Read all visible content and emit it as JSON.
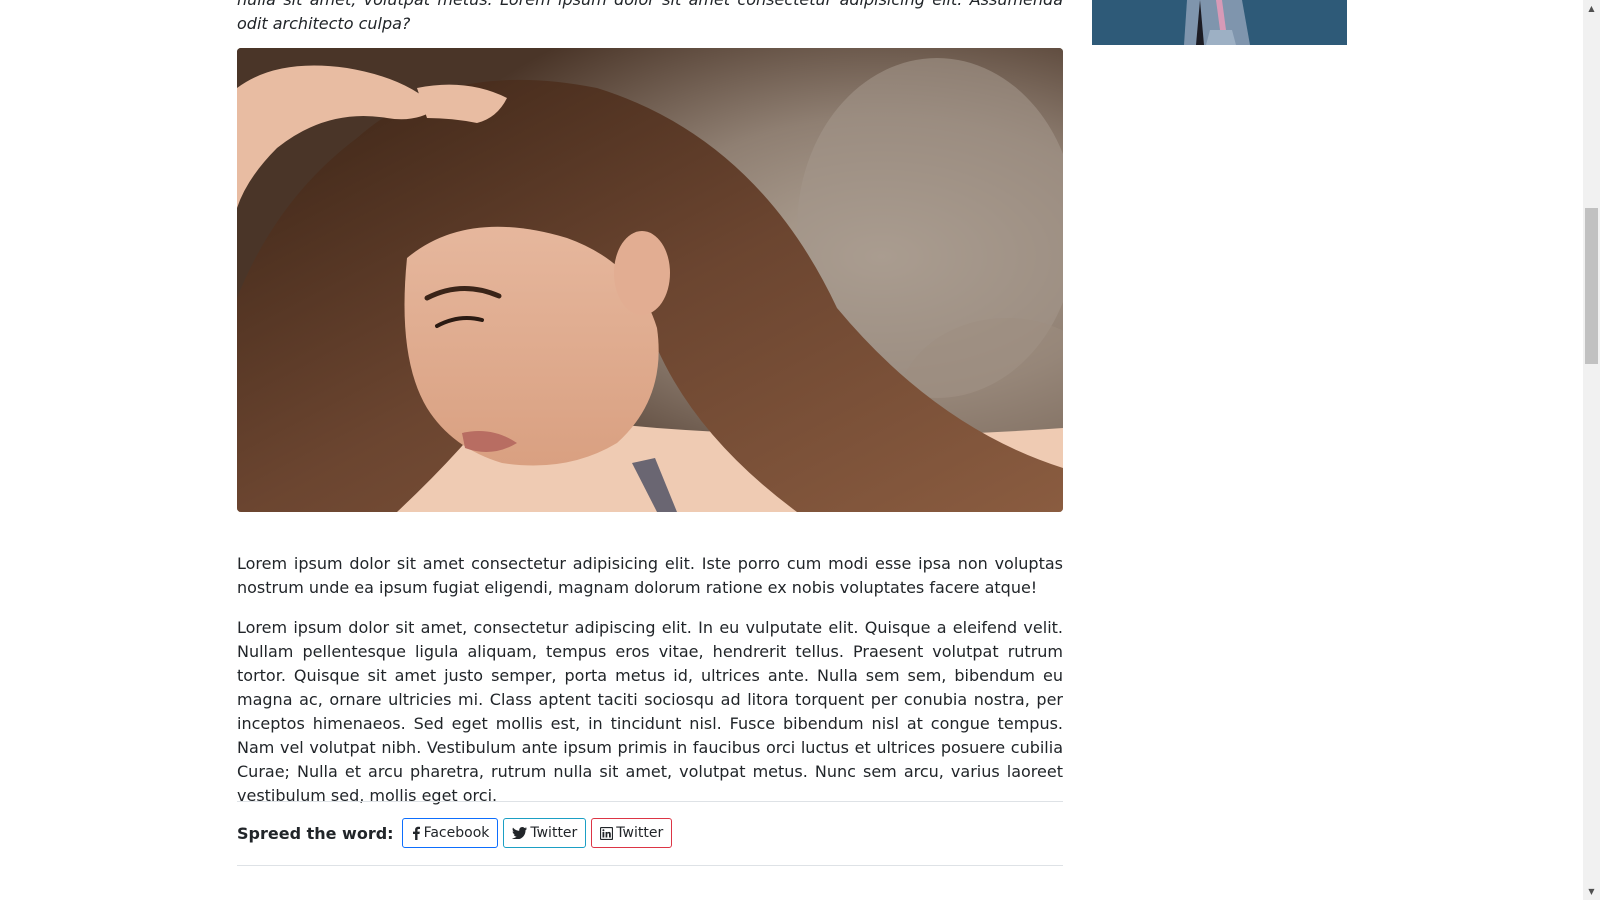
{
  "article": {
    "intro_partial": "nulla sit amet, volutpat metus. Lorem ipsum dolor sit amet consectetur adipisicing elit. Assumenda odit architecto culpa?",
    "paragraph_1": "Lorem ipsum dolor sit amet consectetur adipisicing elit. Iste porro cum modi esse ipsa non voluptas nostrum unde ea ipsum fugiat eligendi, magnam dolorum ratione ex nobis voluptates facere atque!",
    "paragraph_2": "Lorem ipsum dolor sit amet, consectetur adipiscing elit. In eu vulputate elit. Quisque a eleifend velit. Nullam pellentesque ligula aliquam, tempus eros vitae, hendrerit tellus. Praesent volutpat rutrum tortor. Quisque sit amet justo semper, porta metus id, ultrices ante. Nulla sem sem, bibendum eu magna ac, ornare ultricies mi. Class aptent taciti sociosqu ad litora torquent per conubia nostra, per inceptos himenaeos. Sed eget mollis est, in tincidunt nisl. Fusce bibendum nisl at congue tempus. Nam vel volutpat nibh. Vestibulum ante ipsum primis in faucibus orci luctus et ultrices posuere cubilia Curae; Nulla et arcu pharetra, rutrum nulla sit amet, volutpat metus. Nunc sem arcu, varius laoreet vestibulum sed, mollis eget orci."
  },
  "share": {
    "label": "Spreed the word:",
    "buttons": [
      {
        "label": "Facebook",
        "icon": "facebook-icon",
        "color": "#0d6efd"
      },
      {
        "label": "Twitter",
        "icon": "twitter-icon",
        "color": "#1b9fc4"
      },
      {
        "label": "Twitter",
        "icon": "linkedin-icon",
        "color": "#dc3545"
      }
    ]
  }
}
